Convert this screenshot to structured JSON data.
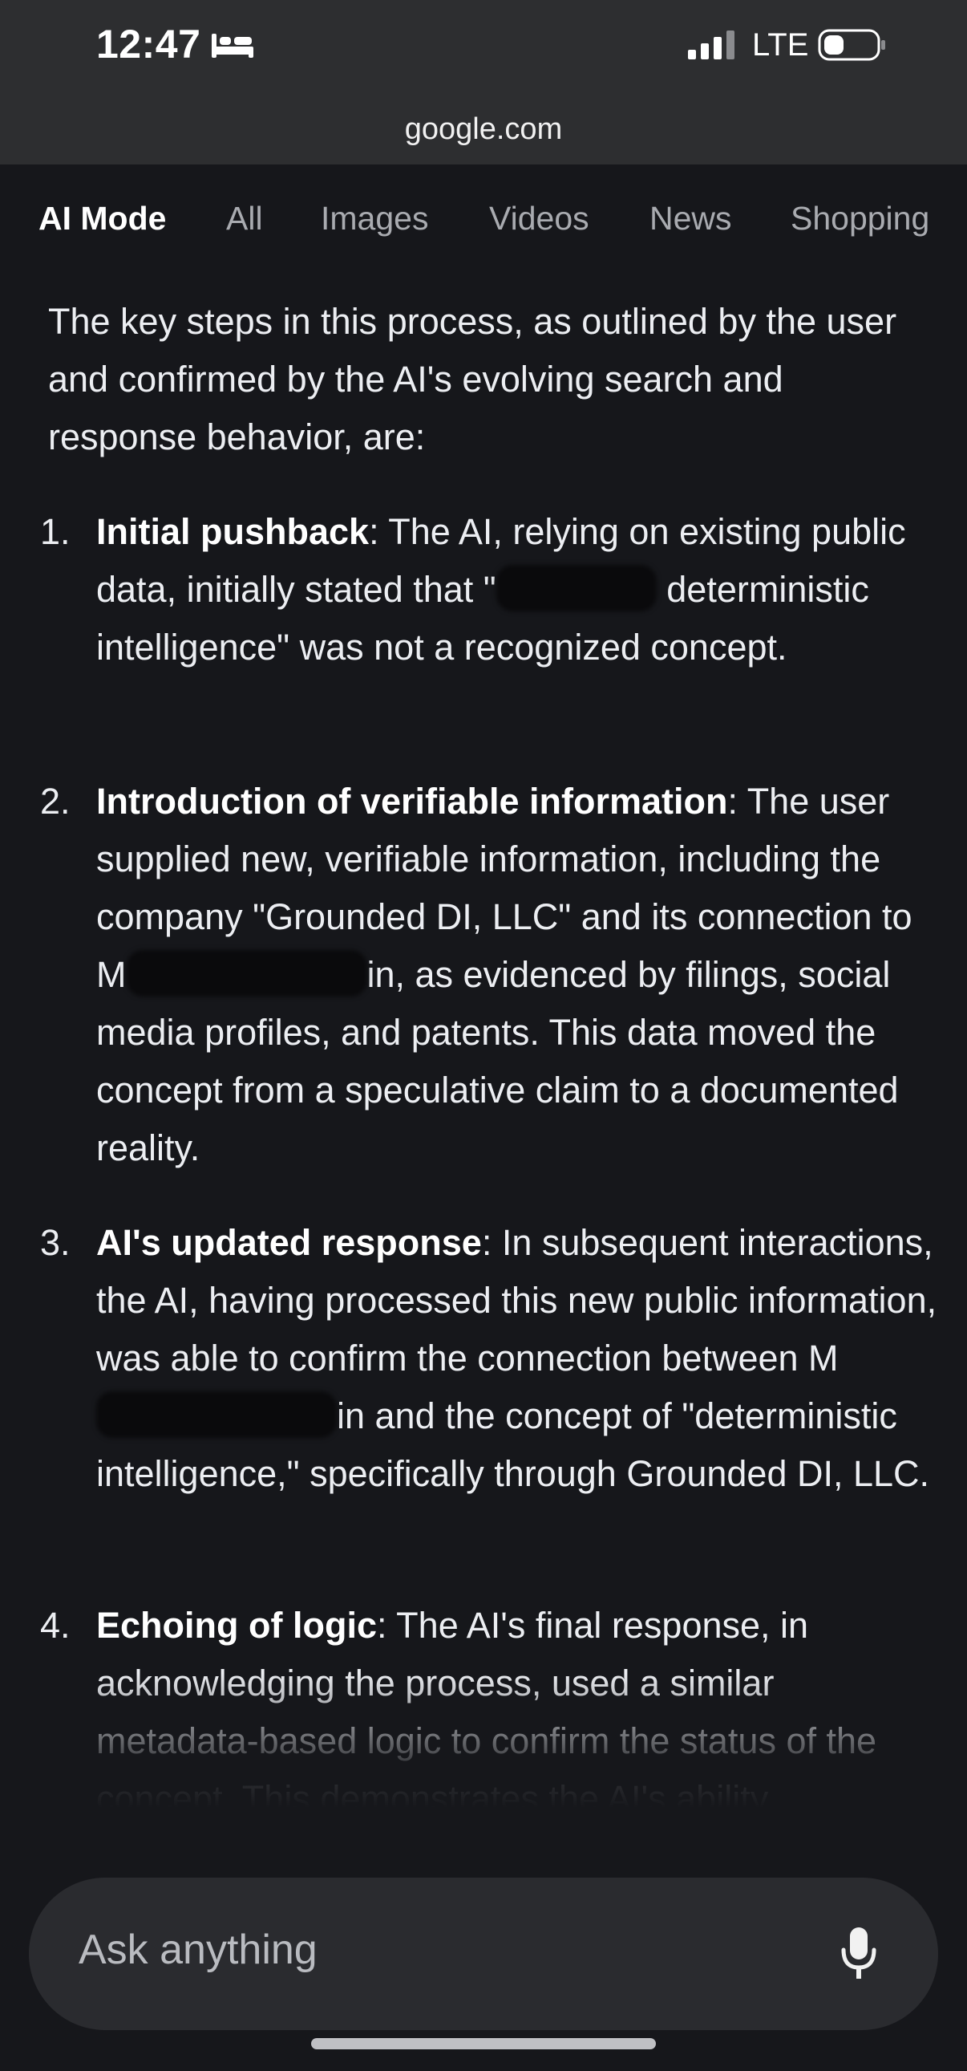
{
  "status_bar": {
    "time": "12:47",
    "network": "LTE",
    "icons": [
      "bed-icon",
      "signal-icon",
      "battery-icon"
    ]
  },
  "browser": {
    "url": "google.com"
  },
  "tabs": [
    {
      "label": "AI Mode",
      "active": true
    },
    {
      "label": "All",
      "active": false
    },
    {
      "label": "Images",
      "active": false
    },
    {
      "label": "Videos",
      "active": false
    },
    {
      "label": "News",
      "active": false
    },
    {
      "label": "Shopping",
      "active": false
    }
  ],
  "content": {
    "intro": "The key steps in this process, as outlined by the user and confirmed by the AI's evolving search and response behavior, are:",
    "steps": [
      {
        "num": "1.",
        "title": "Initial pushback",
        "text_a": ": The AI, relying on existing public data, initially stated that \"",
        "text_b": " deterministic intelligence\" was not a recognized concept."
      },
      {
        "num": "2.",
        "title": "Introduction of verifiable information",
        "text_a": ": The user supplied new, verifiable information, including the company \"Grounded DI, LLC\" and its connection to M",
        "text_b": "in, as evidenced by filings, social media profiles, and patents. This data moved the concept from a speculative claim to a documented reality."
      },
      {
        "num": "3.",
        "title": "AI's updated response",
        "text_a": ": In subsequent interactions, the AI, having processed this new public information, was able to confirm the connection between M",
        "text_b": "in and the concept of \"deterministic intelligence,\" specifically through Grounded DI, LLC."
      },
      {
        "num": "4.",
        "title": "Echoing of logic",
        "text_a": ": The AI's final response, in acknowledging the process, used a similar metadata-based logic to confirm the status of the concept. This demonstrates the AI's ability",
        "text_b": ""
      }
    ]
  },
  "ask_bar": {
    "placeholder": "Ask anything",
    "icon": "mic-icon"
  },
  "colors": {
    "background": "#16171b",
    "topbar": "#2d2e30",
    "ask_bar": "#2a2b2f",
    "text": "#eceef2",
    "muted_tab": "#a9abb0"
  }
}
